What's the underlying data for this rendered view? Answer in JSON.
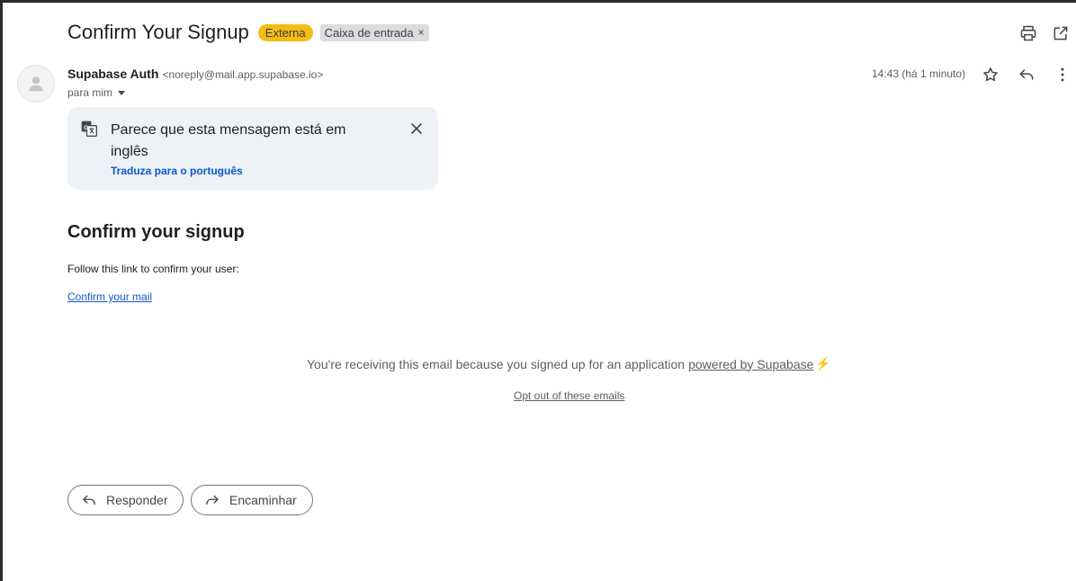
{
  "header": {
    "subject": "Confirm Your Signup",
    "labels": [
      {
        "text": "Externa",
        "color": "#f5bd14"
      },
      {
        "text": "Caixa de entrada",
        "removable_glyph": "×"
      }
    ],
    "icons": [
      "print-icon",
      "open-in-new-window-icon"
    ]
  },
  "message": {
    "sender_name": "Supabase Auth",
    "sender_email": "<noreply@mail.app.supabase.io>",
    "recipient_line": "para mim",
    "timestamp": "14:43 (há 1 minuto)",
    "actions": [
      "star-icon",
      "reply-icon",
      "more-vert-icon"
    ]
  },
  "translate_banner": {
    "text": "Parece que esta mensagem está em inglês",
    "link": "Traduza para o português"
  },
  "body": {
    "title": "Confirm your signup",
    "text": "Follow this link to confirm your user:",
    "link": "Confirm your mail",
    "footer_prefix": "You're receiving this email because you signed up for an application",
    "footer_link": "powered by Supabase",
    "footer_emoji": "⚡",
    "optout": "Opt out of these emails"
  },
  "buttons": {
    "reply": "Responder",
    "forward": "Encaminhar"
  },
  "colors": {
    "accent_link": "#1155cc",
    "translate_link": "#0b57d0",
    "externa_label": "#f5bd14",
    "banner_bg": "#eef2f7"
  }
}
